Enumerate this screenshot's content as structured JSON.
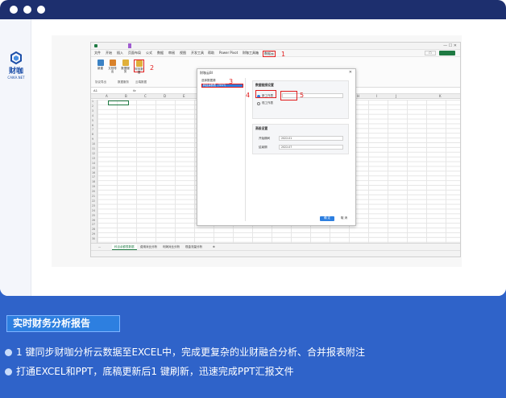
{
  "window": {
    "controls": [
      "dot",
      "dot",
      "dot"
    ]
  },
  "brand": {
    "name": "财咖",
    "sub": "CAIKA.NET"
  },
  "excel": {
    "menu": [
      "文件",
      "开始",
      "插入",
      "页面布局",
      "公式",
      "数据",
      "审阅",
      "视图",
      "开发工具",
      "帮助",
      "Power Pivot",
      "财咖工具箱",
      "数据云"
    ],
    "ribbon_buttons": [
      "新建",
      "文档导出",
      "数据服务",
      "财务数据"
    ],
    "ribbon_groups": [
      "协议导出",
      "数据服务",
      "云端数据"
    ],
    "name_box": "A1",
    "fx": "fx",
    "columns": [
      "A",
      "B",
      "C",
      "D",
      "E",
      "F",
      "G",
      "H",
      "I",
      "J",
      "K"
    ],
    "rows": [
      "1",
      "2",
      "3",
      "4",
      "5",
      "6",
      "7",
      "8",
      "9",
      "10",
      "11",
      "12",
      "13",
      "14",
      "15",
      "16",
      "17",
      "18",
      "19",
      "20",
      "21",
      "22",
      "23",
      "24",
      "25",
      "26",
      "27",
      "28",
      "29",
      "30"
    ],
    "sheets": [
      "...",
      "科目余额表数据",
      "费用对比分析",
      "利润对比分析",
      "现金流量分析"
    ]
  },
  "dialog": {
    "title": "财咖云BI",
    "tree_root": "选择数据源",
    "tree_item": "科目余额表（TEST）",
    "panel1_title": "数据链接设置",
    "radio1": "新工作表",
    "radio2": "现工作表",
    "panel2_title": "高级设置",
    "field1_label": "开始期间",
    "field1_value": "2022-01",
    "field2_label": "结束期",
    "field2_value": "2022-07",
    "ok": "确 定",
    "cancel": "取 消"
  },
  "callouts": [
    "1",
    "2",
    "3",
    "4",
    "5"
  ],
  "section": {
    "badge": "实时财务分析报告",
    "bullets": [
      "1 键同步财咖分析云数据至EXCEL中，完成更复杂的业财融合分析、合并报表附注",
      "打通EXCEL和PPT，底稿更新后1 键刷新，迅速完成PPT汇报文件"
    ]
  },
  "colors": {
    "brand_blue": "#2f63c9",
    "titlebar": "#1d2f6e",
    "accent": "#2d7fe0",
    "red_callout": "#e11d1d"
  }
}
